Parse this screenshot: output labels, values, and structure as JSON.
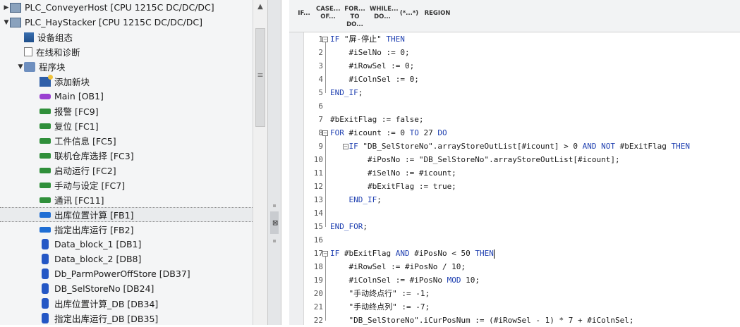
{
  "tree": {
    "items": [
      {
        "label": "PLC_ConveyerHost [CPU 1215C DC/DC/DC]",
        "icon": "plc-icon",
        "indent": 0,
        "arrow": "▶"
      },
      {
        "label": "PLC_HayStacker [CPU 1215C DC/DC/DC]",
        "icon": "plc-icon",
        "indent": 0,
        "arrow": "▼"
      },
      {
        "label": "设备组态",
        "icon": "device-config-icon",
        "indent": 1,
        "arrow": ""
      },
      {
        "label": "在线和诊断",
        "icon": "online-diagnostics-icon",
        "indent": 1,
        "arrow": ""
      },
      {
        "label": "程序块",
        "icon": "program-blocks-folder-icon",
        "indent": 1,
        "arrow": "▼"
      },
      {
        "label": "添加新块",
        "icon": "add-block-icon",
        "indent": 2,
        "arrow": ""
      },
      {
        "label": "Main [OB1]",
        "icon": "ob-block-icon",
        "indent": 2,
        "arrow": ""
      },
      {
        "label": "报警 [FC9]",
        "icon": "fc-block-icon",
        "indent": 2,
        "arrow": ""
      },
      {
        "label": "复位 [FC1]",
        "icon": "fc-block-icon",
        "indent": 2,
        "arrow": ""
      },
      {
        "label": "工件信息 [FC5]",
        "icon": "fc-block-icon",
        "indent": 2,
        "arrow": ""
      },
      {
        "label": "联机仓库选择 [FC3]",
        "icon": "fc-block-icon",
        "indent": 2,
        "arrow": ""
      },
      {
        "label": "启动运行 [FC2]",
        "icon": "fc-block-icon",
        "indent": 2,
        "arrow": ""
      },
      {
        "label": "手动与设定 [FC7]",
        "icon": "fc-block-icon",
        "indent": 2,
        "arrow": ""
      },
      {
        "label": "通讯 [FC11]",
        "icon": "fc-block-icon",
        "indent": 2,
        "arrow": ""
      },
      {
        "label": "出库位置计算 [FB1]",
        "icon": "fb-block-icon",
        "indent": 2,
        "arrow": "",
        "selected": true
      },
      {
        "label": "指定出库运行 [FB2]",
        "icon": "fb-block-icon",
        "indent": 2,
        "arrow": ""
      },
      {
        "label": "Data_block_1 [DB1]",
        "icon": "db-block-icon",
        "indent": 2,
        "arrow": ""
      },
      {
        "label": "Data_block_2 [DB8]",
        "icon": "db-block-icon",
        "indent": 2,
        "arrow": ""
      },
      {
        "label": "Db_ParmPowerOffStore [DB37]",
        "icon": "db-block-icon",
        "indent": 2,
        "arrow": ""
      },
      {
        "label": "DB_SelStoreNo [DB24]",
        "icon": "db-block-icon",
        "indent": 2,
        "arrow": ""
      },
      {
        "label": "出库位置计算_DB [DB34]",
        "icon": "db-block-icon",
        "indent": 2,
        "arrow": ""
      },
      {
        "label": "指定出库运行_DB [DB35]",
        "icon": "db-block-icon",
        "indent": 2,
        "arrow": ""
      }
    ]
  },
  "toolbar": {
    "buttons": [
      {
        "l1": "IF...",
        "l2": ""
      },
      {
        "l1": "CASE...",
        "l2": "OF..."
      },
      {
        "l1": "FOR...",
        "l2": "TO DO..."
      },
      {
        "l1": "WHILE...",
        "l2": "DO..."
      },
      {
        "l1": "(*...*)",
        "l2": ""
      },
      {
        "l1": "REGION",
        "l2": ""
      }
    ]
  },
  "code": {
    "lines": [
      {
        "n": "1",
        "t": "IF \"屏-停止\" THEN"
      },
      {
        "n": "2",
        "t": "    #iSelNo := 0;"
      },
      {
        "n": "3",
        "t": "    #iRowSel := 0;"
      },
      {
        "n": "4",
        "t": "    #iColnSel := 0;"
      },
      {
        "n": "5",
        "t": "END_IF;"
      },
      {
        "n": "6",
        "t": ""
      },
      {
        "n": "7",
        "t": "#bExitFlag := false;"
      },
      {
        "n": "8",
        "t": "FOR #icount := 0 TO 27 DO"
      },
      {
        "n": "9",
        "t": "    IF \"DB_SelStoreNo\".arrayStoreOutList[#icount] > 0 AND NOT #bExitFlag THEN"
      },
      {
        "n": "10",
        "t": "        #iPosNo := \"DB_SelStoreNo\".arrayStoreOutList[#icount];"
      },
      {
        "n": "11",
        "t": "        #iSelNo := #icount;"
      },
      {
        "n": "12",
        "t": "        #bExitFlag := true;"
      },
      {
        "n": "13",
        "t": "    END_IF;"
      },
      {
        "n": "14",
        "t": ""
      },
      {
        "n": "15",
        "t": "END_FOR;"
      },
      {
        "n": "16",
        "t": ""
      },
      {
        "n": "17",
        "t": "IF #bExitFlag AND #iPosNo < 50 THEN"
      },
      {
        "n": "18",
        "t": "    #iRowSel := #iPosNo / 10;"
      },
      {
        "n": "19",
        "t": "    #iColnSel := #iPosNo MOD 10;"
      },
      {
        "n": "20",
        "t": "    \"手动终点行\" := -1;"
      },
      {
        "n": "21",
        "t": "    \"手动终点列\" := -7;"
      },
      {
        "n": "22",
        "t": "    \"DB_SelStoreNo\".iCurPosNum := (#iRowSel - 1) * 7 + #iColnSel;"
      }
    ]
  }
}
